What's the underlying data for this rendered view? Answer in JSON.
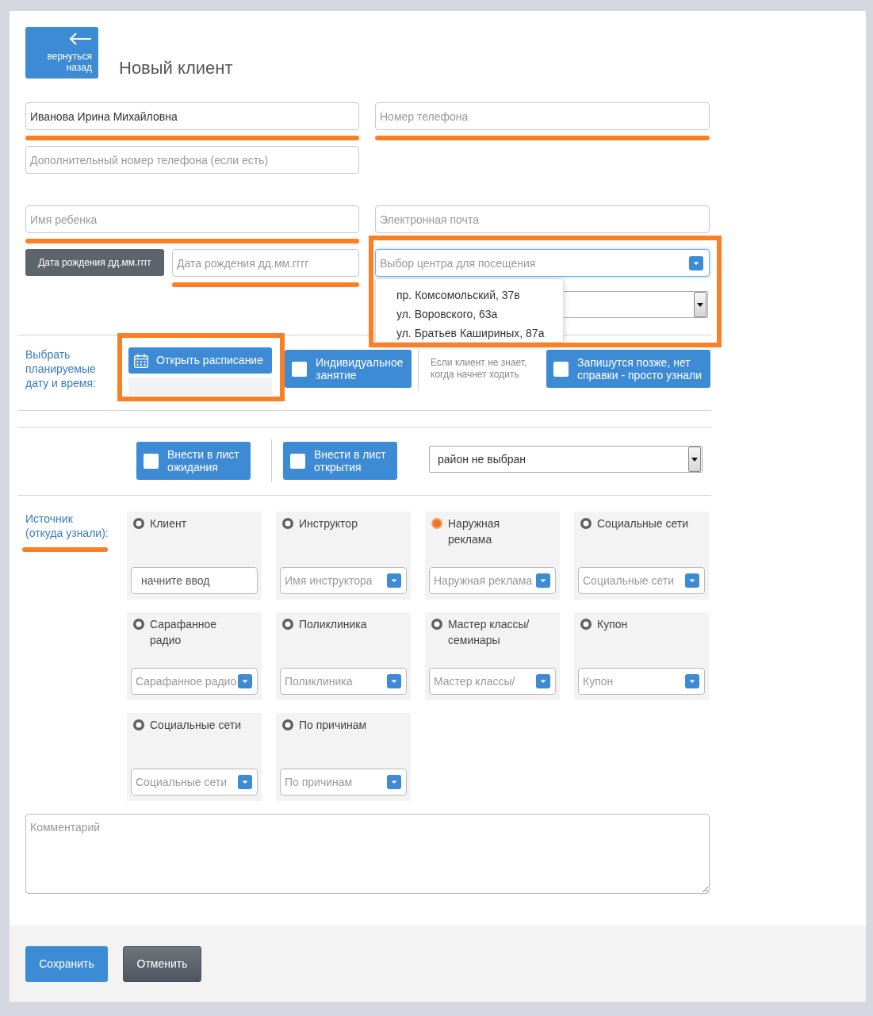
{
  "back_button": {
    "label": "вернуться назад"
  },
  "title": "Новый клиент",
  "contact_rows": [
    [
      {
        "value": "Иванова Ирина Михайловна",
        "underlined": true
      },
      {
        "placeholder": "Номер телефона",
        "underlined": true
      }
    ],
    [
      {
        "placeholder": "Дополнительный номер телефона (если есть)",
        "underlined": false
      }
    ],
    [
      {
        "placeholder": "Имя ребенка",
        "underlined": true
      },
      {
        "placeholder": "Электронная почта",
        "underlined": false
      }
    ]
  ],
  "birth_date": {
    "button": "Дата рождения дд.мм.гггг",
    "placeholder": "Дата рождения дд.мм.гггг",
    "underlined": true
  },
  "center_select": {
    "placeholder": "Выбор центра для посещения",
    "expanded": true,
    "outlined": true,
    "options": [
      {
        "label": "пр. Комсомольский, 37в",
        "selected": false
      },
      {
        "label": "ул. Воровского, 63а",
        "selected": false
      },
      {
        "label": "ул. Братьев Кашириных, 87а",
        "selected": false
      }
    ]
  },
  "schedule": {
    "label": "Выбрать планируемые дату и время:",
    "button": "Открыть расписание",
    "outlined": true
  },
  "schedule_options": [
    {
      "kind": "checkbox",
      "label": "Индивидуальное занятие",
      "checked": false
    },
    {
      "kind": "note",
      "text": "Если клиент не знает, когда начнет ходить"
    },
    {
      "kind": "checkbox",
      "label": "Запишутся позже, нет справки - просто узнали",
      "checked": false
    }
  ],
  "list_actions": [
    {
      "label": "Внести в лист ожидания",
      "checked": false
    },
    {
      "label": "Внести в лист открытия",
      "checked": false
    }
  ],
  "district_select": {
    "value": "район не выбран"
  },
  "source": {
    "label": "Источник (откуда узнали):",
    "underlined": true,
    "options": [
      {
        "label": "Клиент",
        "selected": false,
        "field": {
          "kind": "input",
          "value": "начните ввод"
        }
      },
      {
        "label": "Инструктор",
        "selected": false,
        "field": {
          "kind": "select",
          "placeholder": "Имя инструктора"
        }
      },
      {
        "label": "Наружная реклама",
        "selected": true,
        "field": {
          "kind": "select",
          "placeholder": "Наружная реклама"
        }
      },
      {
        "label": "Социальные сети",
        "selected": false,
        "field": {
          "kind": "select",
          "placeholder": "Социальные сети"
        }
      },
      {
        "label": "Сарафанное радио",
        "selected": false,
        "field": {
          "kind": "select",
          "placeholder": "Сарафанное радио"
        }
      },
      {
        "label": "Поликлиника",
        "selected": false,
        "field": {
          "kind": "select",
          "placeholder": "Поликлиника"
        }
      },
      {
        "label": "Мастер классы/ семинары",
        "selected": false,
        "field": {
          "kind": "select",
          "placeholder": "Мастер классы/"
        }
      },
      {
        "label": "Купон",
        "selected": false,
        "field": {
          "kind": "select",
          "placeholder": "Купон"
        }
      },
      {
        "label": "Социальные сети",
        "selected": false,
        "field": {
          "kind": "select",
          "placeholder": "Социальные сети"
        }
      },
      {
        "label": "По причинам",
        "selected": false,
        "field": {
          "kind": "select",
          "placeholder": "По причинам"
        }
      }
    ]
  },
  "comment": {
    "placeholder": "Комментарий"
  },
  "footer_buttons": [
    {
      "kind": "primary",
      "label": "Сохранить"
    },
    {
      "kind": "secondary",
      "label": "Отменить"
    }
  ]
}
